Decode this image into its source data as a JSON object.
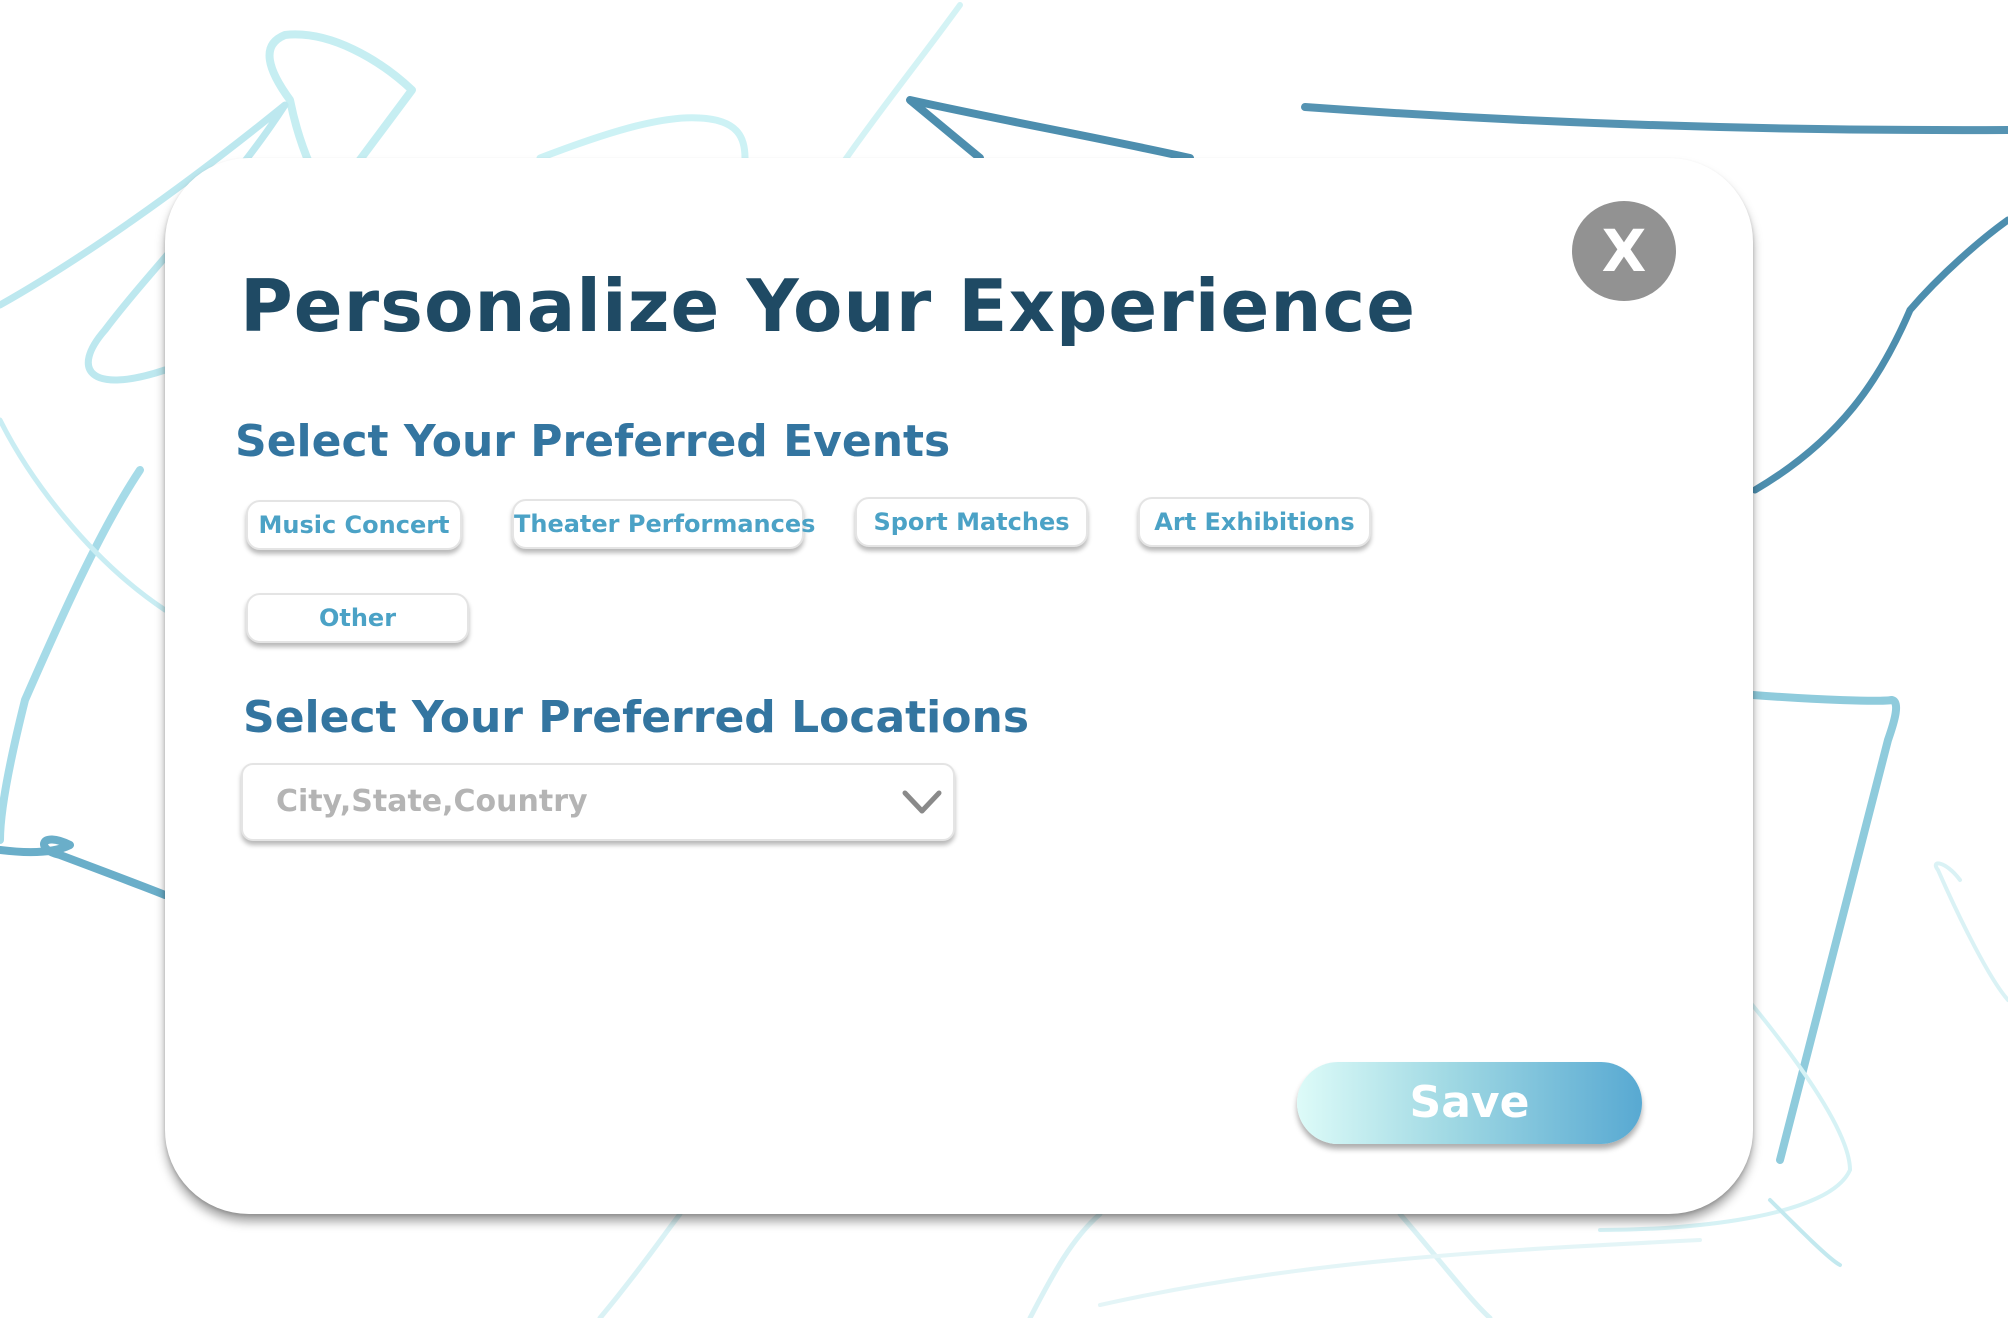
{
  "modal": {
    "title": "Personalize Your Experience",
    "close_label": "X"
  },
  "events": {
    "heading": "Select Your Preferred Events",
    "options": [
      {
        "label": "Music Concert"
      },
      {
        "label": "Theater Performances"
      },
      {
        "label": "Sport Matches"
      },
      {
        "label": "Art Exhibitions"
      },
      {
        "label": "Other"
      }
    ]
  },
  "locations": {
    "heading": "Select Your Preferred Locations",
    "placeholder": "City,State,Country",
    "icon": "chevron-down-icon"
  },
  "actions": {
    "save_label": "Save"
  },
  "colors": {
    "title": "#1f4a64",
    "heading": "#3375a0",
    "chip_text": "#4ba2c6",
    "close_button": "#929292",
    "save_gradient_start": "#ddfbf8",
    "save_gradient_end": "#58a9d2"
  }
}
